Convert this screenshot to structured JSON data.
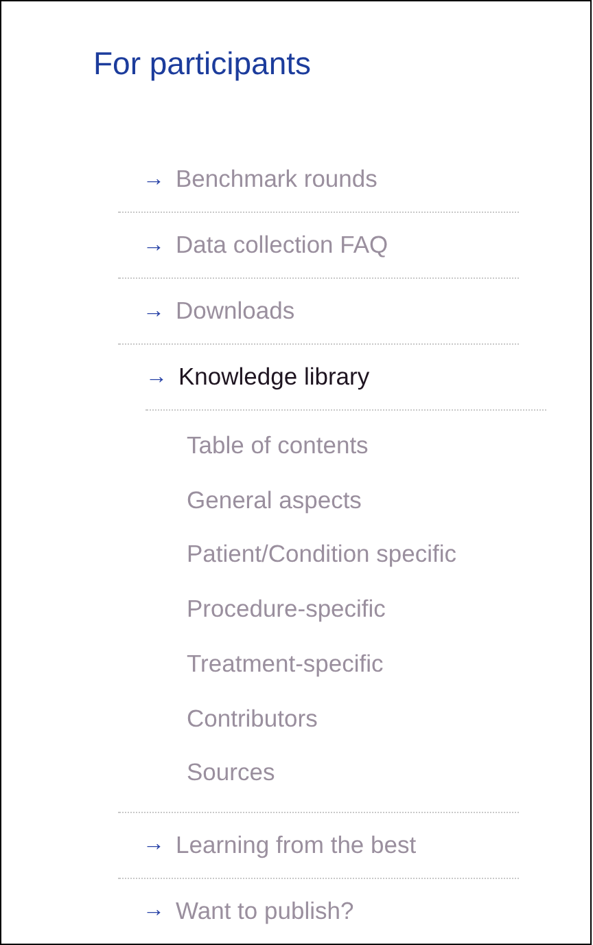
{
  "title": "For participants",
  "items": [
    {
      "arrow": "→",
      "label": "Benchmark rounds",
      "selected": false
    },
    {
      "arrow": "→",
      "label": "Data collection FAQ",
      "selected": false
    },
    {
      "arrow": "→",
      "label": "Downloads",
      "selected": false
    },
    {
      "arrow": "→",
      "label": "Knowledge library",
      "selected": true,
      "children": [
        {
          "label": "Table of contents"
        },
        {
          "label": "General aspects"
        },
        {
          "label": "Patient/Condition specific"
        },
        {
          "label": "Procedure-specific"
        },
        {
          "label": "Treatment-specific"
        },
        {
          "label": "Contributors"
        },
        {
          "label": "Sources"
        }
      ]
    },
    {
      "arrow": "→",
      "label": "Learning from the best",
      "selected": false
    },
    {
      "arrow": "→",
      "label": "Want to publish?",
      "selected": false
    }
  ]
}
